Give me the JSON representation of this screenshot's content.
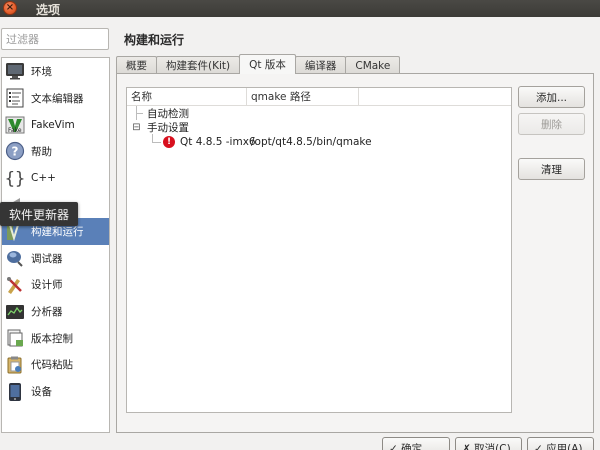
{
  "window": {
    "title": "选项"
  },
  "filter": {
    "placeholder": "过滤器"
  },
  "sidebar": {
    "items": [
      {
        "label": "环境",
        "icon": "monitor-icon"
      },
      {
        "label": "文本编辑器",
        "icon": "text-editor-icon"
      },
      {
        "label": "FakeVim",
        "icon": "fakevim-icon"
      },
      {
        "label": "帮助",
        "icon": "help-icon"
      },
      {
        "label": "C++",
        "icon": "cpp-braces-icon"
      },
      {
        "label": "",
        "icon": "hidden-item-icon"
      },
      {
        "label": "构建和运行",
        "icon": "build-run-icon"
      },
      {
        "label": "调试器",
        "icon": "debugger-icon"
      },
      {
        "label": "设计师",
        "icon": "designer-icon"
      },
      {
        "label": "分析器",
        "icon": "analyzer-icon"
      },
      {
        "label": "版本控制",
        "icon": "version-control-icon"
      },
      {
        "label": "代码粘贴",
        "icon": "code-paste-icon"
      },
      {
        "label": "设备",
        "icon": "device-icon"
      }
    ],
    "active_index": 6
  },
  "tooltip": {
    "text": "软件更新器"
  },
  "main": {
    "title": "构建和运行",
    "tabs": [
      {
        "label": "概要"
      },
      {
        "label": "构建套件(Kit)"
      },
      {
        "label": "Qt 版本"
      },
      {
        "label": "编译器"
      },
      {
        "label": "CMake"
      }
    ],
    "active_tab": 2,
    "table": {
      "columns": [
        "名称",
        "qmake 路径"
      ],
      "groups": [
        {
          "label": "自动检测",
          "expanded": false
        },
        {
          "label": "手动设置",
          "expanded": true,
          "expander": "⊟"
        }
      ],
      "entries": [
        {
          "name": "Qt 4.8.5 -imx6",
          "path": "/opt/qt4.8.5/bin/qmake",
          "status": "error",
          "status_glyph": "!"
        }
      ]
    },
    "buttons": {
      "add": "添加...",
      "remove": "删除",
      "clean": "清理"
    }
  },
  "footer": {
    "ok": "✓ 确定",
    "cancel": "✗ 取消(C)",
    "apply": "✓ 应用(A)"
  },
  "colors": {
    "selection": "#5a80b8",
    "titlebar": "#3c3b37",
    "error": "#d8101e"
  }
}
